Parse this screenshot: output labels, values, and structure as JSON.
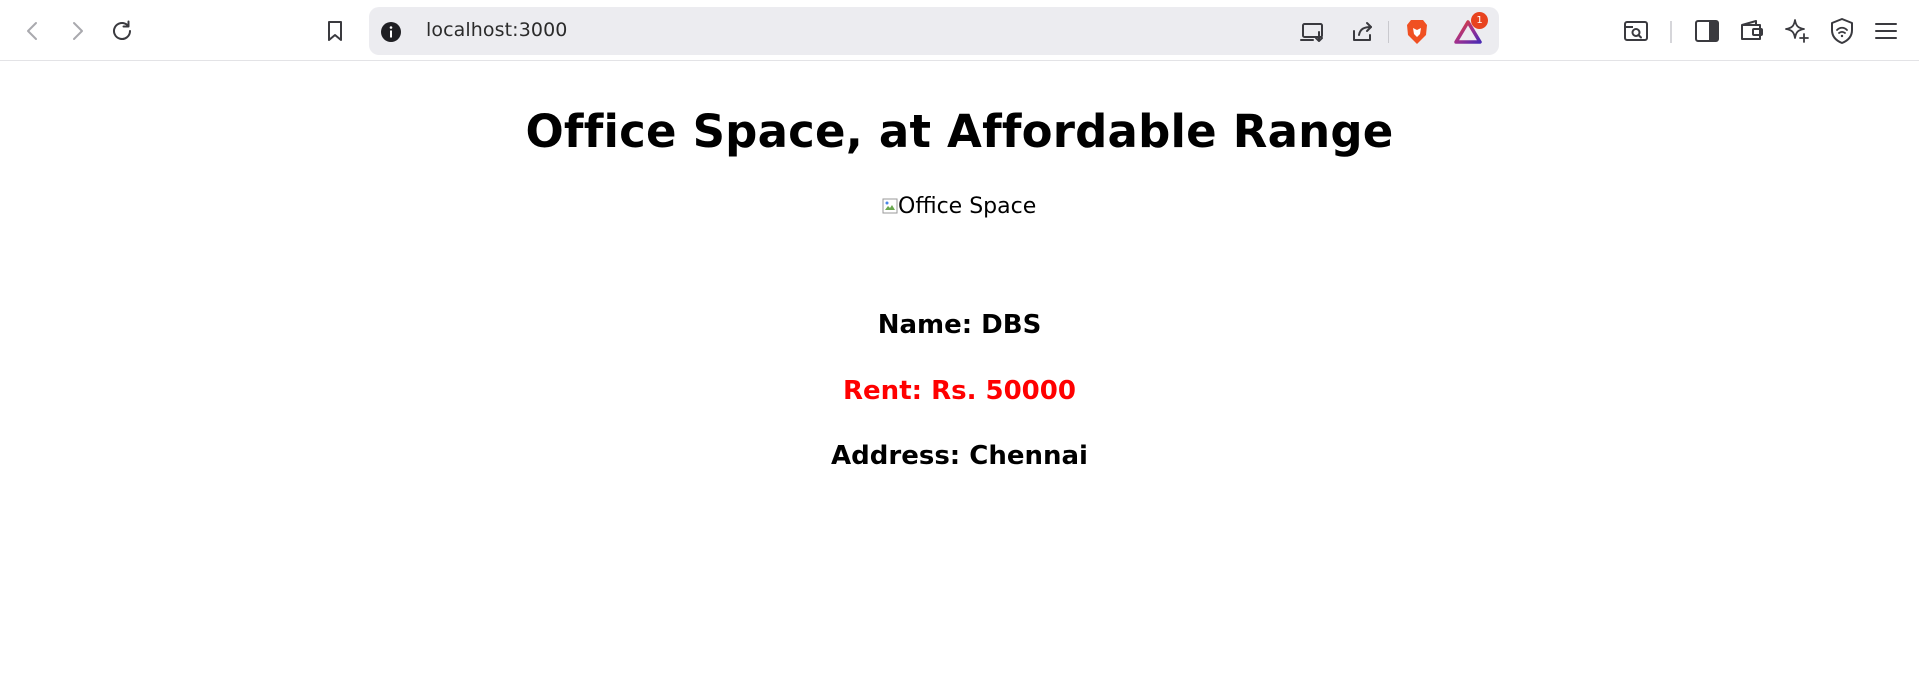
{
  "browser": {
    "url": "localhost:3000",
    "rewards_badge_count": "1",
    "icons": {
      "back": "back-arrow-icon",
      "forward": "forward-arrow-icon",
      "reload": "reload-icon",
      "bookmark": "bookmark-icon",
      "site_info": "info-icon",
      "install": "install-app-icon",
      "share": "share-icon",
      "brave_shields": "brave-lion-icon",
      "rewards": "brave-rewards-icon",
      "tab_search": "tab-search-icon",
      "sidebar": "sidebar-icon",
      "wallet": "wallet-icon",
      "leo": "leo-ai-icon",
      "vpn": "vpn-shield-icon",
      "menu": "hamburger-menu-icon"
    }
  },
  "page": {
    "title": "Office Space, at Affordable Range",
    "image_alt": "Office Space",
    "name_line": "Name: DBS",
    "rent_line": "Rent: Rs. 50000",
    "address_line": "Address: Chennai"
  },
  "colors": {
    "rent_text": "#ff0000",
    "brave_orange": "#f05022",
    "url_bar_bg": "#ececf0"
  }
}
